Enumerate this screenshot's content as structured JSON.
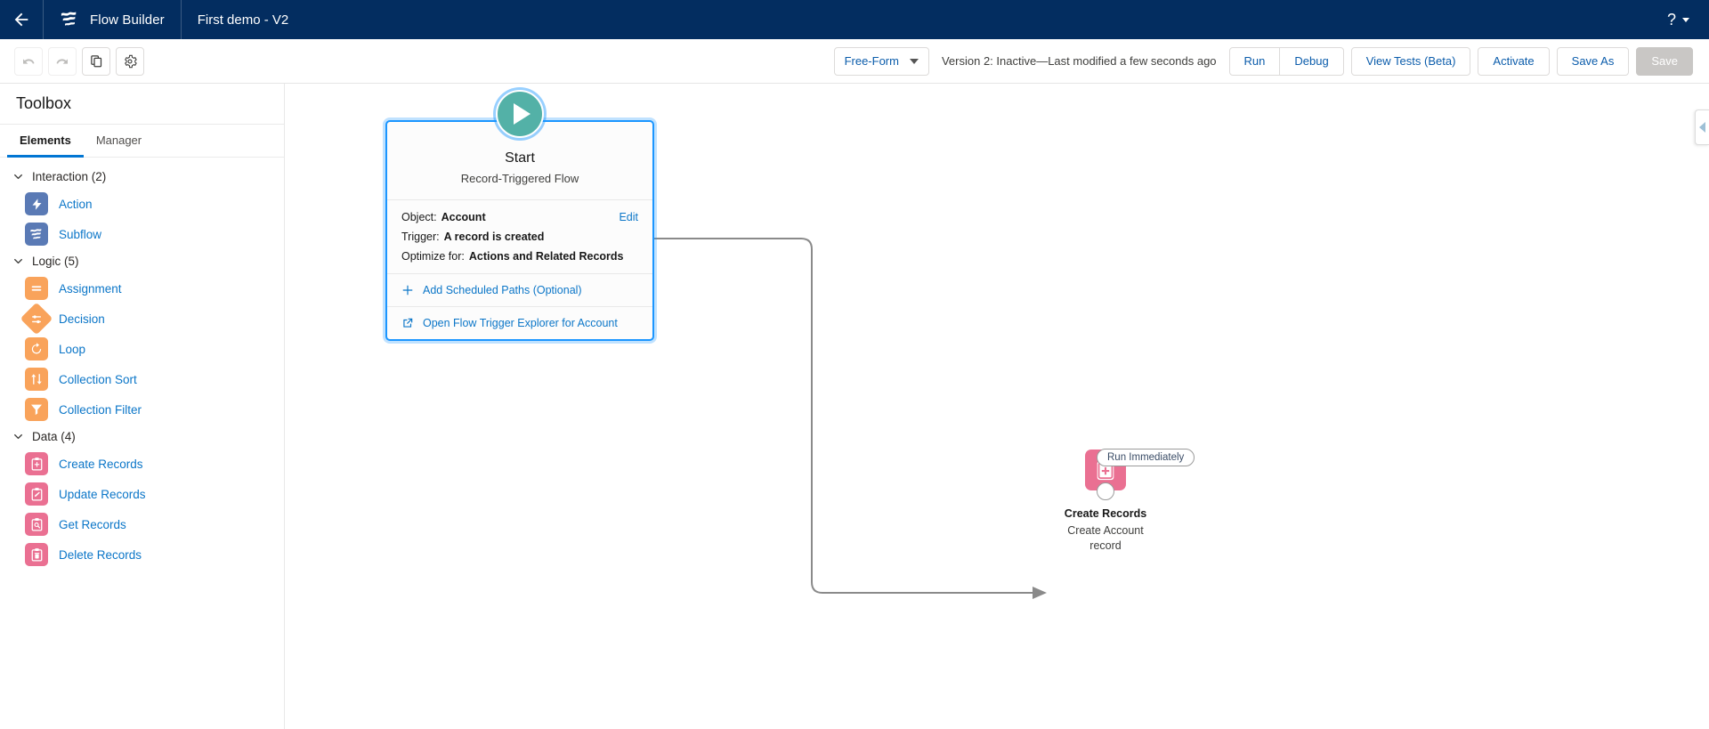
{
  "header": {
    "back_icon": "arrow-left-icon",
    "app_logo_icon": "flow-builder-logo-icon",
    "app_name": "Flow Builder",
    "flow_name": "First demo - V2",
    "help_label": "?",
    "brand_color": "#032d60"
  },
  "toolbar": {
    "undo_icon": "undo-icon",
    "redo_icon": "redo-icon",
    "copy_icon": "copy-icon",
    "settings_icon": "gear-icon",
    "mode_label": "Free-Form",
    "version_status": "Version 2: Inactive—Last modified a few seconds ago",
    "run_label": "Run",
    "debug_label": "Debug",
    "view_tests_label": "View Tests (Beta)",
    "activate_label": "Activate",
    "save_as_label": "Save As",
    "save_label": "Save",
    "link_color": "#0b5cab"
  },
  "toolbox": {
    "title": "Toolbox",
    "tabs": [
      {
        "label": "Elements",
        "active": true
      },
      {
        "label": "Manager",
        "active": false
      }
    ],
    "sections": [
      {
        "label": "Interaction (2)",
        "expanded": true,
        "items": [
          {
            "label": "Action",
            "icon": "action-bolt-icon",
            "color": "#5a7ab5"
          },
          {
            "label": "Subflow",
            "icon": "subflow-icon",
            "color": "#5a7ab5"
          }
        ]
      },
      {
        "label": "Logic (5)",
        "expanded": true,
        "items": [
          {
            "label": "Assignment",
            "icon": "assignment-icon",
            "color": "#f9a35b"
          },
          {
            "label": "Decision",
            "icon": "decision-icon",
            "color": "#f9a35b",
            "shape": "diamond"
          },
          {
            "label": "Loop",
            "icon": "loop-icon",
            "color": "#f9a35b"
          },
          {
            "label": "Collection Sort",
            "icon": "collection-sort-icon",
            "color": "#f9a35b"
          },
          {
            "label": "Collection Filter",
            "icon": "collection-filter-icon",
            "color": "#f9a35b"
          }
        ]
      },
      {
        "label": "Data (4)",
        "expanded": true,
        "items": [
          {
            "label": "Create Records",
            "icon": "create-records-icon",
            "color": "#ea7092"
          },
          {
            "label": "Update Records",
            "icon": "update-records-icon",
            "color": "#ea7092"
          },
          {
            "label": "Get Records",
            "icon": "get-records-icon",
            "color": "#ea7092"
          },
          {
            "label": "Delete Records",
            "icon": "delete-records-icon",
            "color": "#ea7092"
          }
        ]
      }
    ]
  },
  "canvas": {
    "start_node": {
      "play_icon": "play-triangle-icon",
      "title": "Start",
      "subtitle": "Record-Triggered Flow",
      "details": [
        {
          "label": "Object:",
          "value": "Account"
        },
        {
          "label": "Trigger:",
          "value": "A record is created"
        },
        {
          "label": "Optimize for:",
          "value": "Actions and Related Records"
        }
      ],
      "edit_label": "Edit",
      "actions": [
        {
          "label": "Add Scheduled Paths (Optional)",
          "icon": "plus-icon"
        },
        {
          "label": "Open Flow Trigger Explorer for Account",
          "icon": "external-link-icon"
        }
      ],
      "selected": true,
      "selection_color": "#1b96ff",
      "play_color": "#53b1a7"
    },
    "connector_label": "Run Immediately",
    "create_node": {
      "icon": "create-records-icon",
      "icon_color": "#ea7092",
      "label": "Create Records",
      "description": "Create Account record"
    },
    "right_panel_toggle_icon": "chevron-left-icon"
  }
}
